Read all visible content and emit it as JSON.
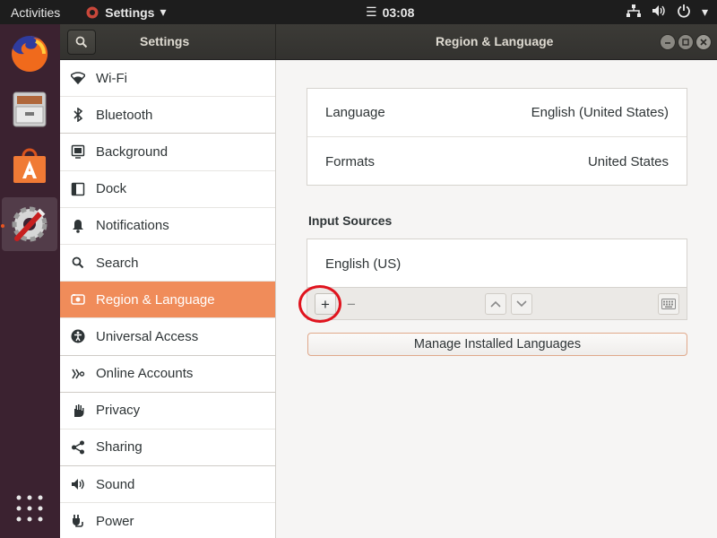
{
  "topbar": {
    "activities": "Activities",
    "app_name": "Settings",
    "clock": "03:08"
  },
  "dock": {
    "items": [
      {
        "name": "Firefox"
      },
      {
        "name": "Files"
      },
      {
        "name": "Ubuntu Software"
      },
      {
        "name": "Settings"
      }
    ]
  },
  "window": {
    "sidebar_title": "Settings",
    "panel_title": "Region & Language"
  },
  "sidebar": {
    "items": [
      {
        "label": "Wi-Fi",
        "icon": "wifi-icon"
      },
      {
        "label": "Bluetooth",
        "icon": "bluetooth-icon"
      },
      {
        "label": "Background",
        "icon": "background-icon"
      },
      {
        "label": "Dock",
        "icon": "dock-icon"
      },
      {
        "label": "Notifications",
        "icon": "bell-icon"
      },
      {
        "label": "Search",
        "icon": "search-icon"
      },
      {
        "label": "Region & Language",
        "icon": "region-icon",
        "selected": true
      },
      {
        "label": "Universal Access",
        "icon": "accessibility-icon"
      },
      {
        "label": "Online Accounts",
        "icon": "online-accounts-icon"
      },
      {
        "label": "Privacy",
        "icon": "hand-icon"
      },
      {
        "label": "Sharing",
        "icon": "share-icon"
      },
      {
        "label": "Sound",
        "icon": "speaker-icon"
      },
      {
        "label": "Power",
        "icon": "power-plug-icon"
      }
    ]
  },
  "main": {
    "language_label": "Language",
    "language_value": "English (United States)",
    "formats_label": "Formats",
    "formats_value": "United States",
    "input_sources_title": "Input Sources",
    "input_sources": [
      "English (US)"
    ],
    "add_symbol": "+",
    "remove_symbol": "−",
    "manage_button": "Manage Installed Languages"
  },
  "colors": {
    "accent": "#f08c5a",
    "highlight_ring": "#e0141e",
    "headerbar": "#3c3b37"
  }
}
